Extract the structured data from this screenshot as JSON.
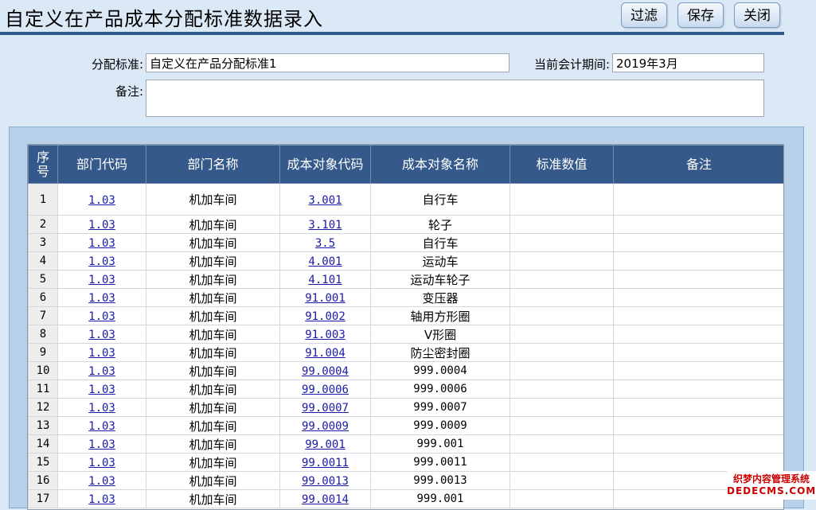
{
  "header": {
    "title": "自定义在产品成本分配标准数据录入",
    "buttons": {
      "filter": "过滤",
      "save": "保存",
      "close": "关闭"
    }
  },
  "form": {
    "standard_label": "分配标准:",
    "standard_value": "自定义在产品分配标准1",
    "period_label": "当前会计期间:",
    "period_value": "2019年3月",
    "remark_label": "备注:",
    "remark_value": ""
  },
  "grid": {
    "columns": [
      "序号",
      "部门代码",
      "部门名称",
      "成本对象代码",
      "成本对象名称",
      "标准数值",
      "备注"
    ],
    "rows": [
      {
        "seq": "1",
        "dept_code": "1.03",
        "dept_name": "机加车间",
        "obj_code": "3.001",
        "obj_name": "自行车",
        "std_value": "",
        "remark": ""
      },
      {
        "seq": "2",
        "dept_code": "1.03",
        "dept_name": "机加车间",
        "obj_code": "3.101",
        "obj_name": "轮子",
        "std_value": "",
        "remark": ""
      },
      {
        "seq": "3",
        "dept_code": "1.03",
        "dept_name": "机加车间",
        "obj_code": "3.5",
        "obj_name": "自行车",
        "std_value": "",
        "remark": ""
      },
      {
        "seq": "4",
        "dept_code": "1.03",
        "dept_name": "机加车间",
        "obj_code": "4.001",
        "obj_name": "运动车",
        "std_value": "",
        "remark": ""
      },
      {
        "seq": "5",
        "dept_code": "1.03",
        "dept_name": "机加车间",
        "obj_code": "4.101",
        "obj_name": "运动车轮子",
        "std_value": "",
        "remark": ""
      },
      {
        "seq": "6",
        "dept_code": "1.03",
        "dept_name": "机加车间",
        "obj_code": "91.001",
        "obj_name": "变压器",
        "std_value": "",
        "remark": ""
      },
      {
        "seq": "7",
        "dept_code": "1.03",
        "dept_name": "机加车间",
        "obj_code": "91.002",
        "obj_name": "轴用方形圈",
        "std_value": "",
        "remark": ""
      },
      {
        "seq": "8",
        "dept_code": "1.03",
        "dept_name": "机加车间",
        "obj_code": "91.003",
        "obj_name": "V形圈",
        "std_value": "",
        "remark": ""
      },
      {
        "seq": "9",
        "dept_code": "1.03",
        "dept_name": "机加车间",
        "obj_code": "91.004",
        "obj_name": "防尘密封圈",
        "std_value": "",
        "remark": ""
      },
      {
        "seq": "10",
        "dept_code": "1.03",
        "dept_name": "机加车间",
        "obj_code": "99.0004",
        "obj_name": "999.0004",
        "std_value": "",
        "remark": ""
      },
      {
        "seq": "11",
        "dept_code": "1.03",
        "dept_name": "机加车间",
        "obj_code": "99.0006",
        "obj_name": "999.0006",
        "std_value": "",
        "remark": ""
      },
      {
        "seq": "12",
        "dept_code": "1.03",
        "dept_name": "机加车间",
        "obj_code": "99.0007",
        "obj_name": "999.0007",
        "std_value": "",
        "remark": ""
      },
      {
        "seq": "13",
        "dept_code": "1.03",
        "dept_name": "机加车间",
        "obj_code": "99.0009",
        "obj_name": "999.0009",
        "std_value": "",
        "remark": ""
      },
      {
        "seq": "14",
        "dept_code": "1.03",
        "dept_name": "机加车间",
        "obj_code": "99.001",
        "obj_name": "999.001",
        "std_value": "",
        "remark": ""
      },
      {
        "seq": "15",
        "dept_code": "1.03",
        "dept_name": "机加车间",
        "obj_code": "99.0011",
        "obj_name": "999.0011",
        "std_value": "",
        "remark": ""
      },
      {
        "seq": "16",
        "dept_code": "1.03",
        "dept_name": "机加车间",
        "obj_code": "99.0013",
        "obj_name": "999.0013",
        "std_value": "",
        "remark": ""
      },
      {
        "seq": "17",
        "dept_code": "1.03",
        "dept_name": "机加车间",
        "obj_code": "99.0014",
        "obj_name": "999.001",
        "std_value": "",
        "remark": ""
      }
    ]
  },
  "watermark": {
    "line1": "织梦内容管理系统",
    "line2": "DEDECMS.COM"
  }
}
